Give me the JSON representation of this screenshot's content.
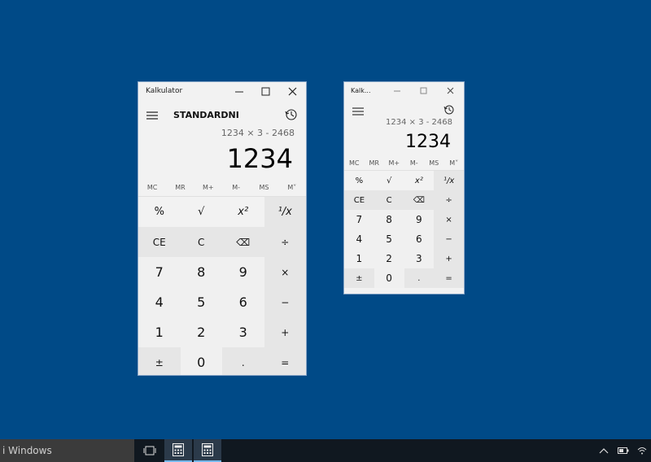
{
  "desktop": {
    "background": "#004a87"
  },
  "large_window": {
    "title": "Kalkulator",
    "mode": "STANDARDNI",
    "expression": "1234 × 3 - 2468",
    "value": "1234",
    "memory": [
      "MC",
      "MR",
      "M+",
      "M-",
      "MS",
      "M˅"
    ],
    "rows": [
      [
        "%",
        "√",
        "x²",
        "¹/x"
      ],
      [
        "CE",
        "C",
        "⌫",
        "÷"
      ],
      [
        "7",
        "8",
        "9",
        "×"
      ],
      [
        "4",
        "5",
        "6",
        "−"
      ],
      [
        "1",
        "2",
        "3",
        "+"
      ],
      [
        "±",
        "0",
        ".",
        "="
      ]
    ]
  },
  "small_window": {
    "title": "Kalk...",
    "expression": "1234 × 3 - 2468",
    "value": "1234",
    "memory": [
      "MC",
      "MR",
      "M+",
      "M-",
      "MS",
      "M˅"
    ],
    "rows": [
      [
        "%",
        "√",
        "x²",
        "¹/x"
      ],
      [
        "CE",
        "C",
        "⌫",
        "÷"
      ],
      [
        "7",
        "8",
        "9",
        "×"
      ],
      [
        "4",
        "5",
        "6",
        "−"
      ],
      [
        "1",
        "2",
        "3",
        "+"
      ],
      [
        "±",
        "0",
        ".",
        "="
      ]
    ]
  },
  "taskbar": {
    "search_text": "i Windows"
  }
}
